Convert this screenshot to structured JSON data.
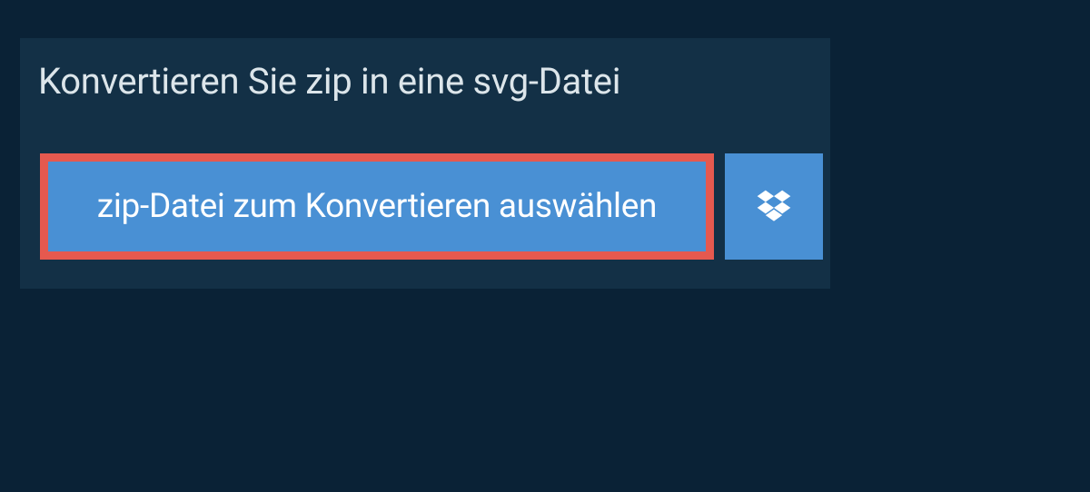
{
  "converter": {
    "title": "Konvertieren Sie zip in eine svg-Datei",
    "file_select_label": "zip-Datei zum Konvertieren auswählen"
  },
  "colors": {
    "background": "#0a2236",
    "panel": "#133046",
    "button": "#4990d4",
    "highlight_border": "#e5594f",
    "text_light": "#dce5ea",
    "text_white": "#ffffff"
  }
}
